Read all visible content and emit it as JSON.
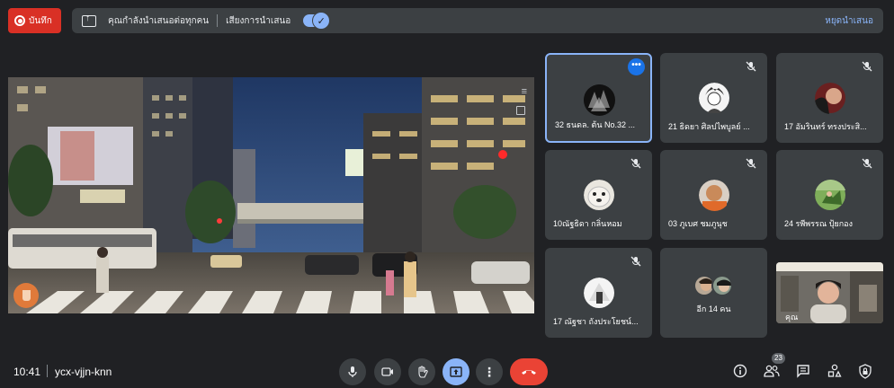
{
  "top": {
    "record_label": "บันทึก",
    "presenting_text": "คุณกำลังนำเสนอต่อทุกคน",
    "audio_label": "เสียงการนำเสนอ",
    "stop_label": "หยุดนำเสนอ"
  },
  "participants": [
    {
      "name": "32 ธนดล. ต้น No.32 ..."
    },
    {
      "name": "21 ธิดยา ศิลปไพบูลย์ ..."
    },
    {
      "name": "17 อัมรินทร์ ทรงประสิ..."
    },
    {
      "name": "10ณัฐธิดา กลิ่นหอม"
    },
    {
      "name": "03 ภูเบศ ชมภูนุช"
    },
    {
      "name": "24 รพีพรรณ ปุ้ยกอง"
    },
    {
      "name": "17 ณัฐชา ถังประโยชน์..."
    }
  ],
  "more_participants": "อีก 14 คน",
  "self_label": "คุณ",
  "bottom": {
    "time": "10:41",
    "meeting_code": "ycx-vjjn-knn",
    "people_count": "23"
  },
  "colors": {
    "record": "#d93025",
    "accent": "#8ab4f8",
    "hangup": "#ea4335",
    "tile": "#3c4043",
    "background": "#202124"
  },
  "icons": {
    "controls": [
      "mic-icon",
      "camera-icon",
      "raise-hand-icon",
      "present-screen-icon",
      "more-options-icon",
      "hang-up-icon"
    ],
    "tools": [
      "info-icon",
      "people-icon",
      "chat-icon",
      "activities-icon",
      "host-controls-icon"
    ]
  }
}
